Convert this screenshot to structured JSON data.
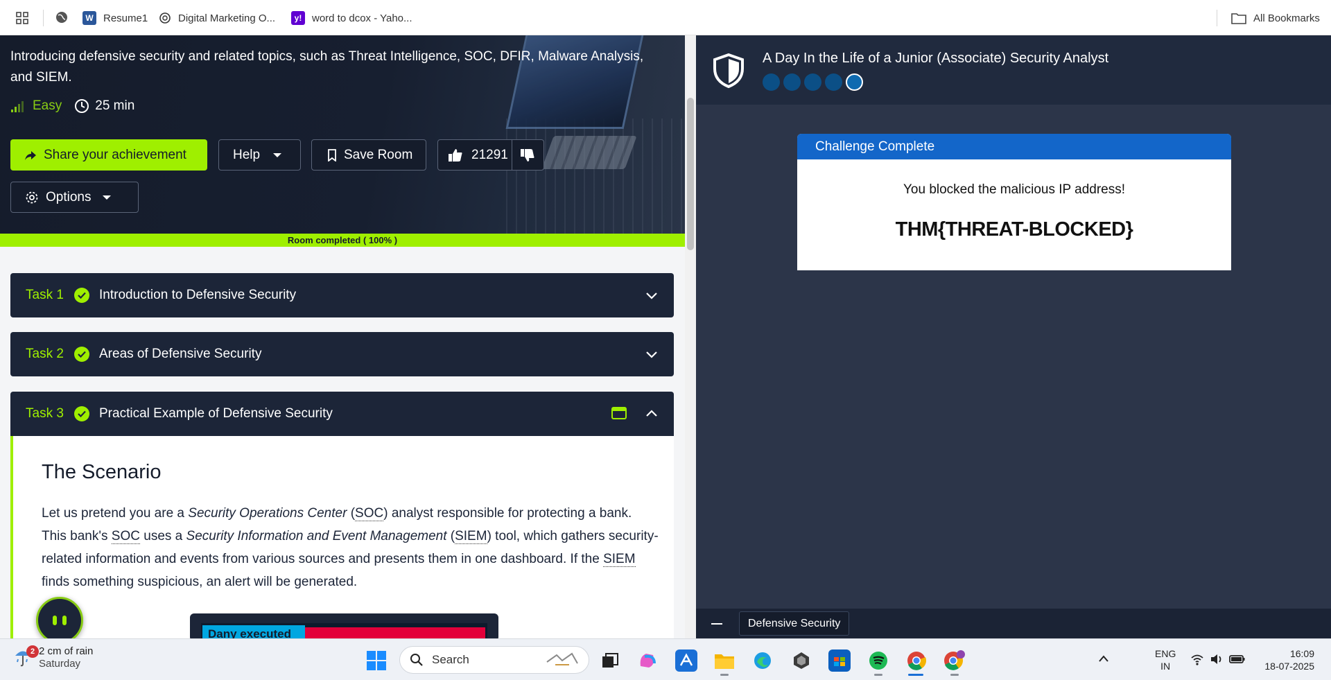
{
  "bookmarks": {
    "items": [
      {
        "label": "Resume1",
        "icon": "word-icon"
      },
      {
        "label": "Digital Marketing O...",
        "icon": "openai-icon"
      },
      {
        "label": "word to dcox - Yaho...",
        "icon": "yahoo-icon"
      }
    ],
    "all_bookmarks": "All Bookmarks"
  },
  "room": {
    "description": "Introducing defensive security and related topics, such as Threat Intelligence, SOC, DFIR, Malware Analysis, and SIEM.",
    "difficulty": "Easy",
    "duration": "25 min",
    "buttons": {
      "share": "Share your achievement",
      "help": "Help",
      "save": "Save Room",
      "likes": "21291",
      "options": "Options"
    },
    "progress_text": "Room completed ( 100% )",
    "progress_fraction": 1.0
  },
  "tasks": [
    {
      "num": "Task 1",
      "title": "Introduction to Defensive Security"
    },
    {
      "num": "Task 2",
      "title": "Areas of Defensive Security"
    },
    {
      "num": "Task 3",
      "title": "Practical Example of Defensive Security"
    }
  ],
  "scenario": {
    "title": "The Scenario",
    "p1": "Let us pretend you are a ",
    "soc_full": "Security Operations Center",
    "soc": "SOC",
    "p2": " analyst responsible for protecting a bank. This bank's ",
    "p3": " uses a ",
    "siem_full": "Security Information and Event Management",
    "siem": "SIEM",
    "p4": " tool, which gathers security-related information and events from various sources and presents them in one dashboard. If the ",
    "p5": " finds something suspicious, an alert will be generated.",
    "image_tag": "Dany executed"
  },
  "right_pane": {
    "title": "A Day In the Life of a Junior (Associate) Security Analyst",
    "steps_total": 5,
    "current_step": 5,
    "card": {
      "header": "Challenge Complete",
      "message": "You blocked the malicious IP address!",
      "flag": "THM{THREAT-BLOCKED}"
    },
    "footer_chip": "Defensive Security"
  },
  "taskbar": {
    "weather_temp": "2 cm of rain",
    "weather_day": "Saturday",
    "weather_badge": "2",
    "search_label": "Search",
    "lang_1": "ENG",
    "lang_2": "IN",
    "time": "16:09",
    "date": "18-07-2025"
  },
  "colors": {
    "accent_green": "#9fef00",
    "hero_bg": "#151c2b",
    "task_bg": "#1c2538",
    "card_header_blue": "#1366c9",
    "right_pane_bg": "#2c3549"
  }
}
